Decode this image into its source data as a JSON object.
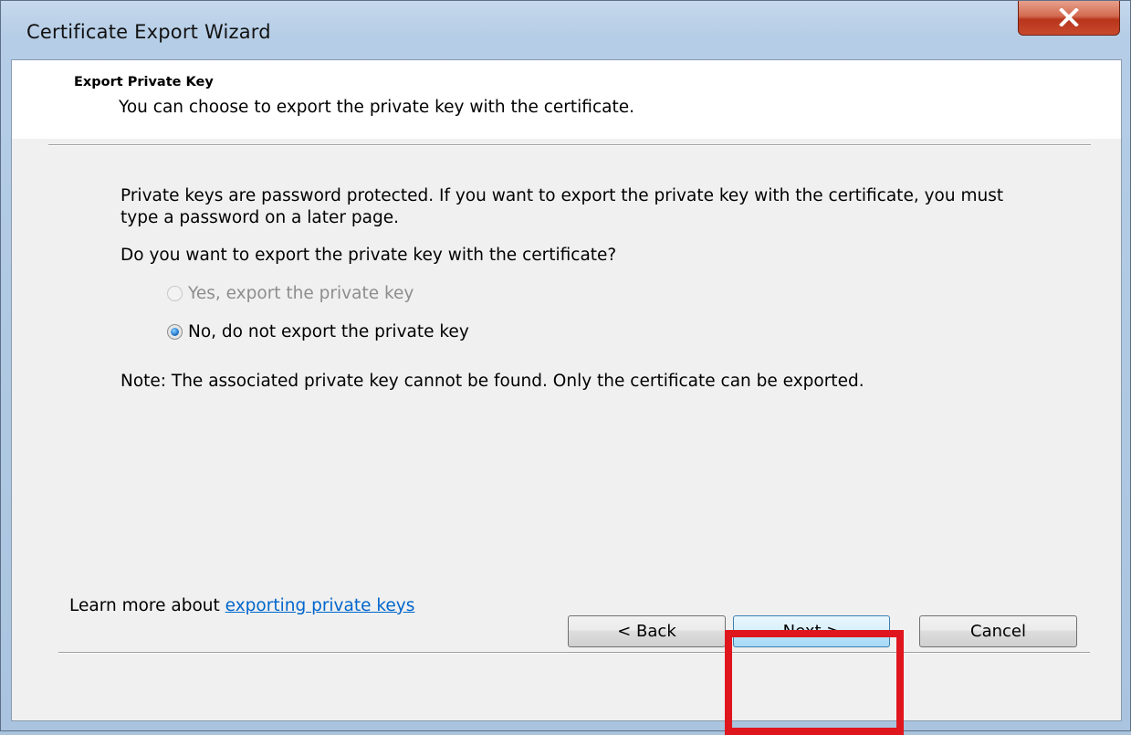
{
  "window": {
    "title": "Certificate Export Wizard"
  },
  "header": {
    "title": "Export Private Key",
    "subtitle": "You can choose to export the private key with the certificate."
  },
  "body": {
    "intro": "Private keys are password protected. If you want to export the private key with the certificate, you must type a password on a later page.",
    "question": "Do you want to export the private key with the certificate?",
    "options": [
      {
        "label": "Yes, export the private key",
        "selected": false,
        "enabled": false
      },
      {
        "label": "No, do not export the private key",
        "selected": true,
        "enabled": true
      }
    ],
    "note": "Note: The associated private key cannot be found. Only the certificate can be exported."
  },
  "learn_more": {
    "prefix": "Learn more about ",
    "link_text": "exporting private keys"
  },
  "buttons": {
    "back": "< Back",
    "next": "Next >",
    "cancel": "Cancel"
  },
  "colors": {
    "highlight": "#e0161e",
    "link": "#0066cc",
    "close_button": "#c8492c"
  }
}
